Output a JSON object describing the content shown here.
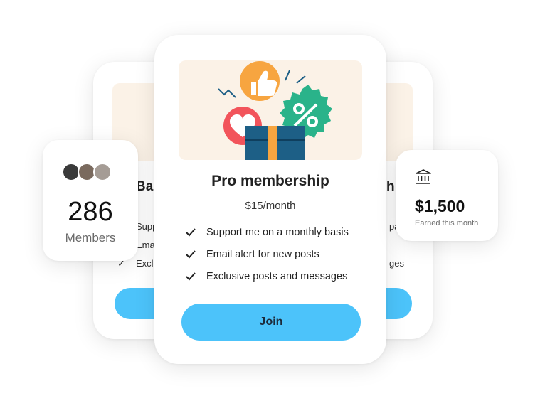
{
  "back_left": {
    "title": "Bas",
    "features": [
      "Supp",
      "Emai",
      "Exclu"
    ]
  },
  "back_right": {
    "title": "h",
    "features": [
      "pa",
      "",
      "ges"
    ]
  },
  "plan": {
    "title": "Pro membership",
    "price": "$15/month",
    "features": [
      "Support me on a monthly basis",
      "Email alert for new posts",
      "Exclusive posts and messages"
    ],
    "join_label": "Join"
  },
  "members": {
    "count": "286",
    "label": "Members"
  },
  "earnings": {
    "amount": "$1,500",
    "label": "Earned this month",
    "icon": "bank-icon"
  },
  "colors": {
    "accent_button": "#4cc3fa",
    "banner_bg": "#fbf2e7",
    "heart_red": "#f2545b",
    "thumb_orange": "#f7a540",
    "badge_green": "#2ab38a",
    "gift_blue": "#1d5f86"
  }
}
